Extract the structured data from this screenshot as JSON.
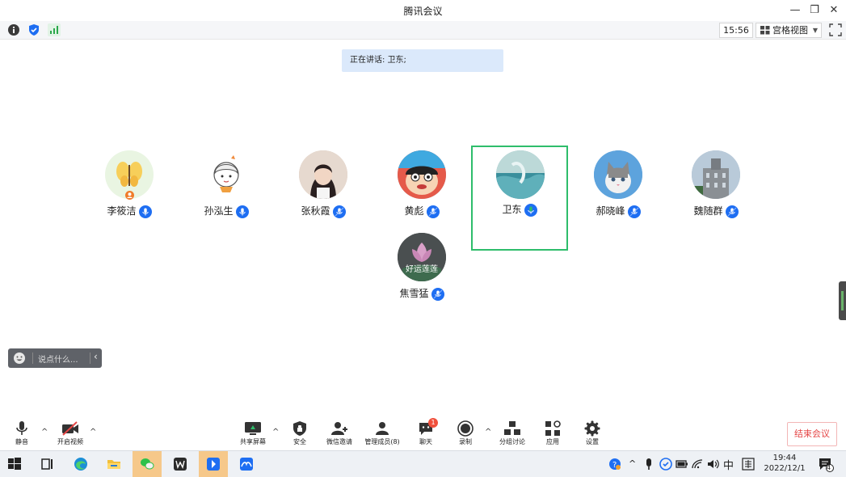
{
  "window": {
    "title": "腾讯会议",
    "minimize_icon": "minimize-icon",
    "restore_icon": "restore-icon",
    "close_icon": "close-icon"
  },
  "topbar": {
    "time": "15:56",
    "view_label": "宫格视图",
    "icons": [
      "info-icon",
      "shield-icon",
      "signal-icon",
      "fullscreen-icon"
    ]
  },
  "speaking_banner": "正在讲话: 卫东;",
  "participants": [
    {
      "name": "李筱洁",
      "avatar": "butterfly",
      "bg": "#e9f5e2"
    },
    {
      "name": "孙泓生",
      "avatar": "cartoon-girl",
      "bg": "#ffffff"
    },
    {
      "name": "张秋霞",
      "avatar": "photo-woman",
      "bg": "#d8c2b3"
    },
    {
      "name": "黄彪",
      "avatar": "cartoon-boy",
      "bg": "#7fb5d8"
    },
    {
      "name": "卫东",
      "avatar": "sea-wave",
      "bg": "#7ab3b9",
      "active": true
    },
    {
      "name": "郝晓峰",
      "avatar": "kitten",
      "bg": "#6ba7d9"
    },
    {
      "name": "魏随群",
      "avatar": "building",
      "bg": "#a9b9c9"
    },
    {
      "name": "焦雪猛",
      "avatar": "lotus",
      "bg": "#4a4f50",
      "avatar_text": "好运莲莲"
    }
  ],
  "chat": {
    "placeholder": "说点什么..."
  },
  "toolbar": {
    "mute": "静音",
    "video": "开启视频",
    "share": "共享屏幕",
    "security": "安全",
    "invite": "微信邀请",
    "members": "管理成员(8)",
    "chat": "聊天",
    "chat_badge": "1",
    "record": "录制",
    "breakout": "分组讨论",
    "apps": "应用",
    "settings": "设置",
    "end": "结束会议"
  },
  "taskbar": {
    "apps": [
      "start-icon",
      "task-view-icon",
      "edge-icon",
      "file-explorer-icon",
      "wechat-icon",
      "wps-icon",
      "app-blue-icon",
      "tencent-meeting-icon"
    ],
    "ime": "中",
    "time": "19:44",
    "date": "2022/12/1",
    "notification_count": "4"
  },
  "colors": {
    "accent": "#1e6ef2",
    "active_border": "#2ebd6b",
    "end_button": "#e54545"
  }
}
